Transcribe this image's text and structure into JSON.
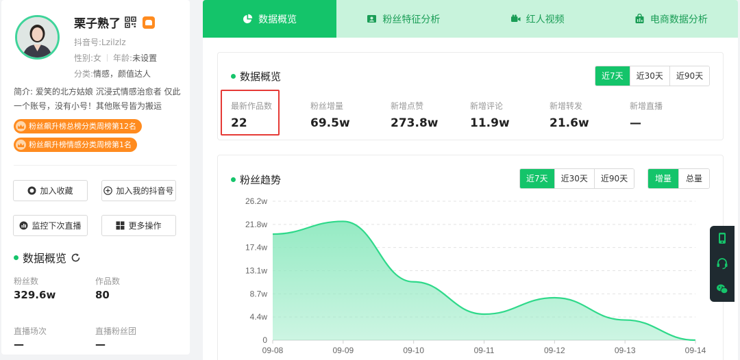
{
  "profile": {
    "name": "栗子熟了",
    "douyin_id": "抖音号:Lzilzlz",
    "gender": "性别:女",
    "age_label": "年龄:",
    "age_value": "未设置",
    "category_label": "分类:",
    "category_value": "情感，颜值达人",
    "intro_label": "简介:",
    "intro_text": "爱笑的北方姑娘 沉浸式情感治愈者 仅此一个账号，没有小号！其他账号皆为搬运",
    "rank_tags": [
      "粉丝飙升榜总榜分类周榜第12名",
      "粉丝飙升榜情感分类周榜第1名"
    ],
    "brand_color": "#14c46a",
    "tag_color": "#ff8b1f"
  },
  "actions": {
    "favorite": "加入收藏",
    "add_my_douyin": "加入我的抖音号",
    "monitor_live": "监控下次直播",
    "more": "更多操作"
  },
  "left_overview": {
    "title": "数据概览",
    "fans_label": "粉丝数",
    "fans_value": "329.6w",
    "works_label": "作品数",
    "works_value": "80",
    "live_label": "直播场次",
    "live_value": "—",
    "fanclub_label": "直播粉丝团",
    "fanclub_value": "—"
  },
  "tabs": [
    {
      "label": "数据概览",
      "icon": "pie-chart-icon"
    },
    {
      "label": "粉丝特征分析",
      "icon": "id-card-icon"
    },
    {
      "label": "红人视频",
      "icon": "video-camera-icon"
    },
    {
      "label": "电商数据分析",
      "icon": "shopping-bag-icon"
    }
  ],
  "overview_card": {
    "title": "数据概览",
    "ranges": [
      "近7天",
      "近30天",
      "近90天"
    ],
    "stats": [
      {
        "label": "最新作品数",
        "value": "22"
      },
      {
        "label": "粉丝增量",
        "value": "69.5w"
      },
      {
        "label": "新增点赞",
        "value": "273.8w"
      },
      {
        "label": "新增评论",
        "value": "11.9w"
      },
      {
        "label": "新增转发",
        "value": "21.6w"
      },
      {
        "label": "新增直播",
        "value": "—"
      }
    ]
  },
  "trend_card": {
    "title": "粉丝趋势",
    "ranges": [
      "近7天",
      "近30天",
      "近90天"
    ],
    "modes": [
      "增量",
      "总量"
    ]
  },
  "chart_data": {
    "type": "area",
    "x": [
      "09-08",
      "09-09",
      "09-10",
      "09-11",
      "09-12",
      "09-13",
      "09-14"
    ],
    "yticks": [
      "26.2w",
      "21.8w",
      "17.4w",
      "13.1w",
      "8.7w",
      "4.4w",
      "0"
    ],
    "ylim": [
      0,
      26.2
    ],
    "unit": "w",
    "values": [
      20.0,
      22.4,
      11.0,
      4.9,
      8.0,
      3.8,
      0.0
    ],
    "grid": true,
    "line_color": "#2fd98a",
    "fill_color": "#8fe9c0"
  }
}
